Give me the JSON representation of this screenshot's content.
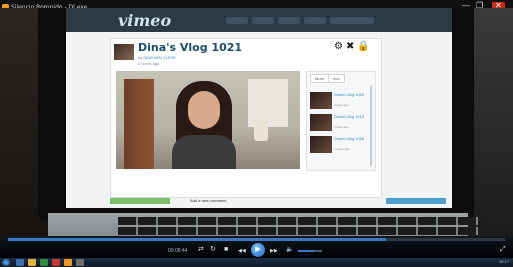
{
  "window": {
    "title": "Silencio Rompido - Dl.exe",
    "minimize_glyph": "—",
    "restore_glyph": "❐",
    "close_glyph": "✕"
  },
  "vimeo": {
    "logo": "vimeo",
    "video_title": "Dina's Vlog 1021",
    "by_prefix": "by",
    "author": "DINA VAN CLEVE",
    "uploaded": "2 hours ago",
    "tool_icons": [
      "gear-icon",
      "close-icon",
      "lock-icon"
    ],
    "tabs": [
      "More",
      "Info"
    ],
    "related": [
      {
        "title": "Dina's Vlog 1020",
        "meta": "2 days ago"
      },
      {
        "title": "Dina's Vlog 1019",
        "meta": "4 days ago"
      },
      {
        "title": "Dina's Vlog 1018",
        "meta": "1 week ago"
      }
    ],
    "lower_caption": "Add a new comment"
  },
  "player": {
    "time": "00:08:44",
    "seek_progress": 0.76,
    "volume_level": 0.65,
    "buttons": {
      "shuffle": "⇄",
      "repeat": "↻",
      "stop": "■",
      "prev": "⏮",
      "rewind": "◀◀",
      "play": "▶",
      "forward": "▶▶",
      "next": "⏭",
      "mute": "🔈",
      "fullscreen": "⤢"
    }
  },
  "taskbar": {
    "clock": "19:17"
  },
  "colors": {
    "vimeo_header": "#2b3a45",
    "seek_accent": "#3a78c2",
    "title_blue": "#1f4c66"
  }
}
